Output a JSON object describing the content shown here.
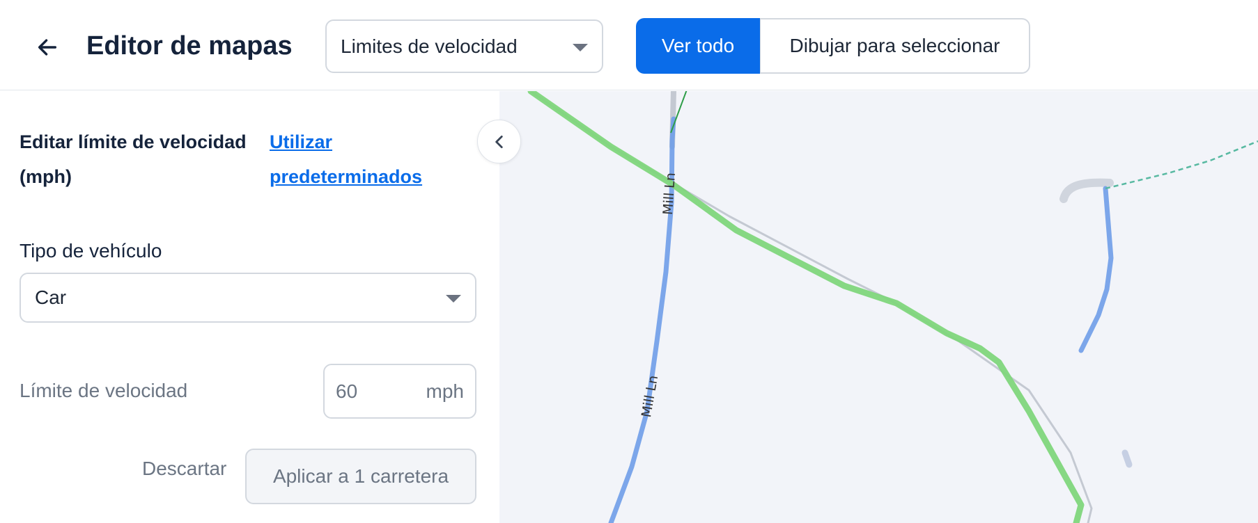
{
  "header": {
    "title": "Editor de mapas",
    "layer_select": {
      "value": "Limites de velocidad"
    },
    "view_all_label": "Ver todo",
    "draw_select_label": "Dibujar para seleccionar"
  },
  "sidebar": {
    "section_title": "Editar límite de velocidad (mph)",
    "defaults_link": "Utilizar predeterminados",
    "vehicle_label": "Tipo de vehículo",
    "vehicle_value": "Car",
    "limit_label": "Límite de velocidad",
    "limit_value": "60",
    "limit_unit": "mph",
    "discard_label": "Descartar",
    "apply_label": "Aplicar a 1 carretera"
  },
  "map": {
    "road_labels": [
      "Mill Ln",
      "Mill Ln"
    ]
  },
  "colors": {
    "accent": "#0a6ce9",
    "road_blue": "#6f9de8",
    "road_green": "#7fd67c"
  }
}
